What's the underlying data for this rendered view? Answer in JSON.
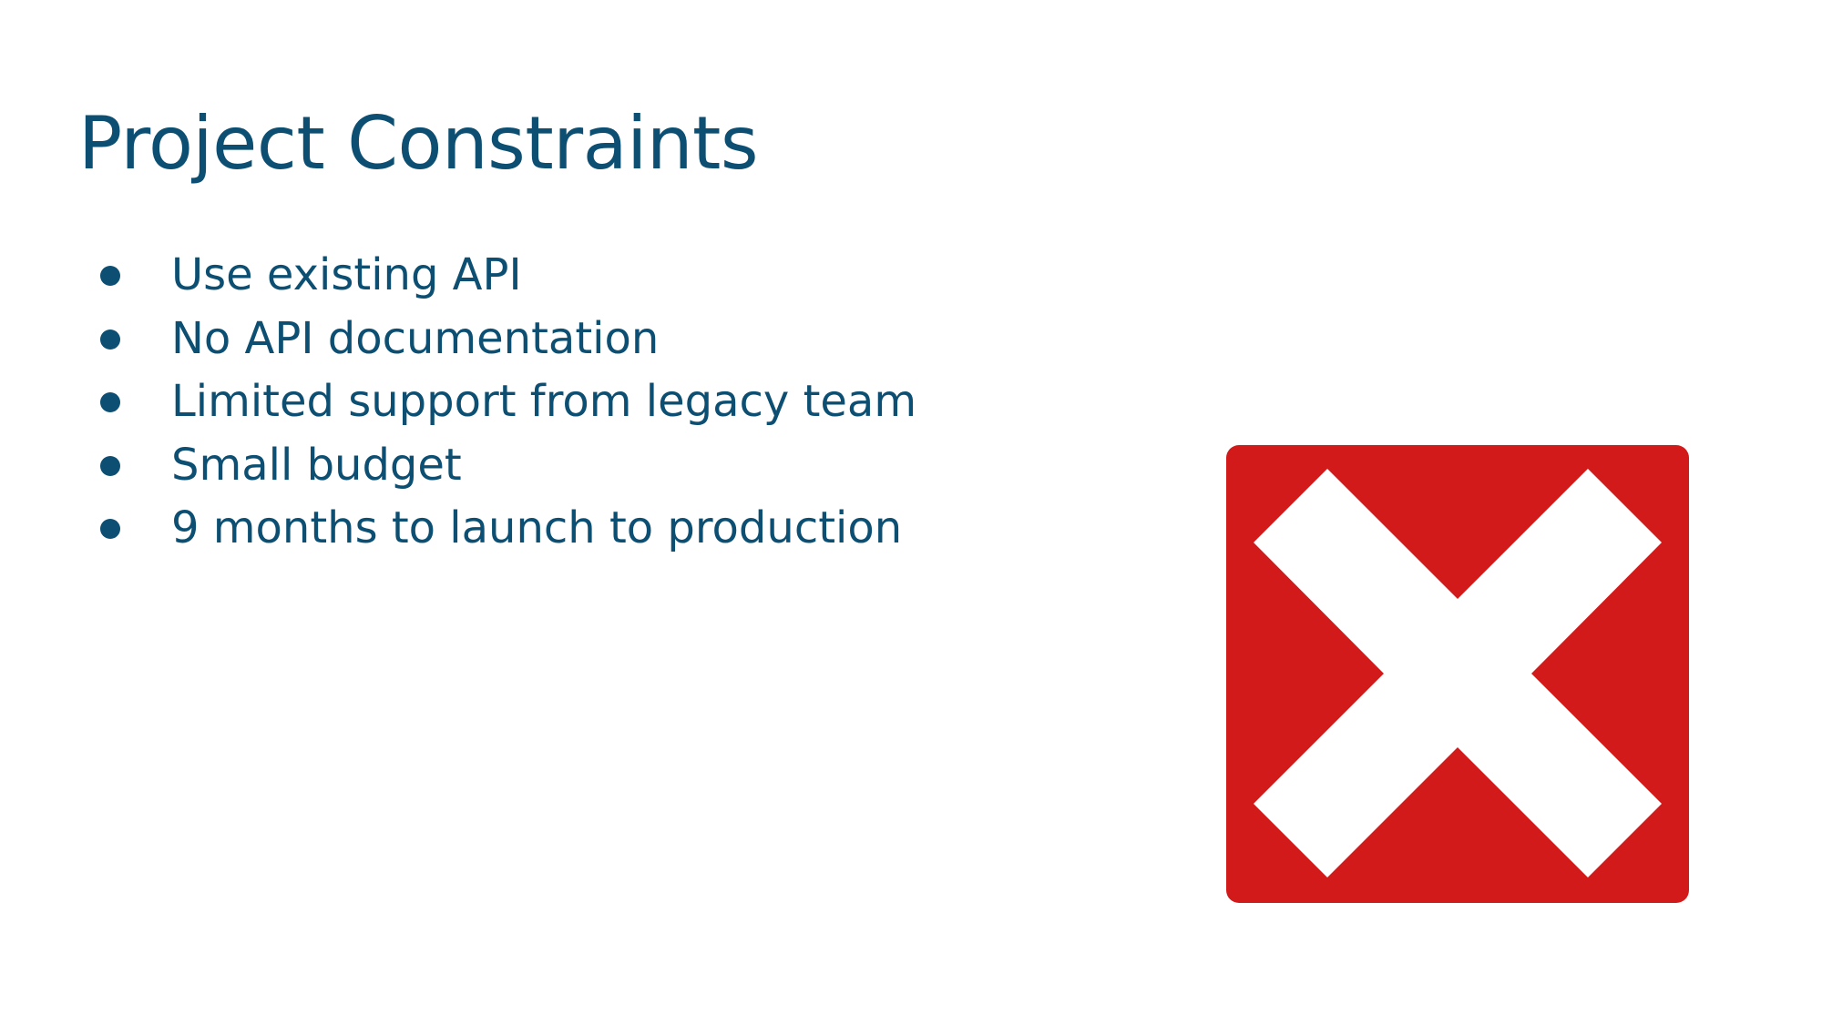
{
  "slide": {
    "title": "Project Constraints",
    "bullets": [
      "Use existing API",
      "No API documentation",
      "Limited support from legacy team",
      "Small budget",
      "9 months to launch to production"
    ],
    "icon": {
      "name": "red-x-mark-icon",
      "background_color": "#d21a1b",
      "mark_color": "#ffffff"
    },
    "text_color": "#0c4f72"
  }
}
